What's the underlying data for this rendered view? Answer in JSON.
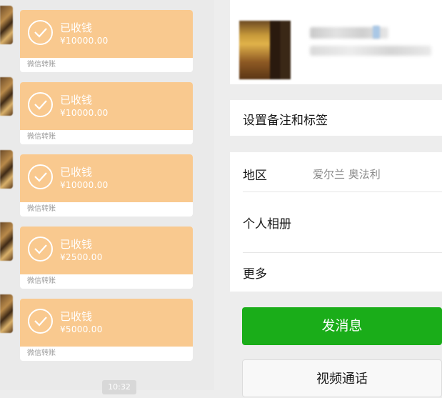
{
  "chat": {
    "transfers": [
      {
        "status": "已收钱",
        "amount": "¥10000.00",
        "footer": "微信转账"
      },
      {
        "status": "已收钱",
        "amount": "¥10000.00",
        "footer": "微信转账"
      },
      {
        "status": "已收钱",
        "amount": "¥10000.00",
        "footer": "微信转账"
      },
      {
        "status": "已收钱",
        "amount": "¥2500.00",
        "footer": "微信转账"
      },
      {
        "status": "已收钱",
        "amount": "¥5000.00",
        "footer": "微信转账"
      }
    ],
    "time_badge": "10:32"
  },
  "profile": {
    "set_remark_label": "设置备注和标签",
    "region_label": "地区",
    "region_value": "爱尔兰  奥法利",
    "album_label": "个人相册",
    "more_label": "更多",
    "send_message_button": "发消息",
    "video_call_button": "视频通话"
  },
  "colors": {
    "transfer_bubble": "#f9c98f",
    "primary_button": "#1aad19",
    "page_background": "#ededed"
  }
}
